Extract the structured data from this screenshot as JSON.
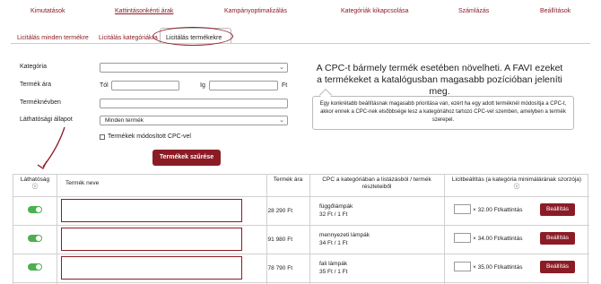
{
  "topnav": {
    "items": [
      "Kimutatások",
      "Kattintásonkénti árak",
      "Kampányoptimalizálás",
      "Kategóriák kikapcsolása",
      "Számlázás",
      "Beállítások"
    ]
  },
  "subnav": {
    "items": [
      "Licitálás minden termékre",
      "Licitálás kategóriákra",
      "Licitálás termékekre"
    ]
  },
  "filters": {
    "category_label": "Kategória",
    "price_label": "Termék ára",
    "from_label": "Tól",
    "to_label": "Ig",
    "currency": "Ft",
    "name_label": "Terméknévben",
    "visibility_label": "Láthatósági állapot",
    "visibility_value": "Minden termék",
    "checkbox_label": "Termékek módosított CPC-vel",
    "filter_button": "Termékek szűrése"
  },
  "info": {
    "heading": "A CPC-t bármely termék esetében növelheti. A FAVI ezeket a termékeket a katalógusban magasabb pozícióban jeleníti meg.",
    "tooltip": "Egy konkrétabb beállításnak magasabb prioritása van, ezért ha egy adott terméknél módosítja a CPC-t, akkor ennek a CPC-nek elsőbbsége lesz a kategóriához tartozó CPC-vel szemben, amelyben a termék szerepel."
  },
  "table": {
    "headers": {
      "visibility": "Láthatóság",
      "name": "Termék neve",
      "price": "Termék ára",
      "cpc": "CPC a kategóriában a listázásból / termék részleteiből",
      "bid": "Licitbeállítás (a kategória minimálárának szorzója)"
    },
    "info_icon": "ⓘ",
    "set_button": "Beállítás",
    "rows": [
      {
        "price": "28 290 Ft",
        "category": "függőlámpák",
        "cpc": "32 Ft / 1 Ft",
        "bid_text": "× 32.00 Ft/kattintás",
        "visible": true
      },
      {
        "price": "91 980 Ft",
        "category": "mennyezeti lámpák",
        "cpc": "34 Ft / 1 Ft",
        "bid_text": "× 34.00 Ft/kattintás",
        "visible": true
      },
      {
        "price": "78 790 Ft",
        "category": "fali lámpák",
        "cpc": "35 Ft / 1 Ft",
        "bid_text": "× 35.00 Ft/kattintás",
        "visible": true
      }
    ]
  },
  "colors": {
    "brand": "#8b1c26",
    "toggle_on": "#4caf50"
  }
}
